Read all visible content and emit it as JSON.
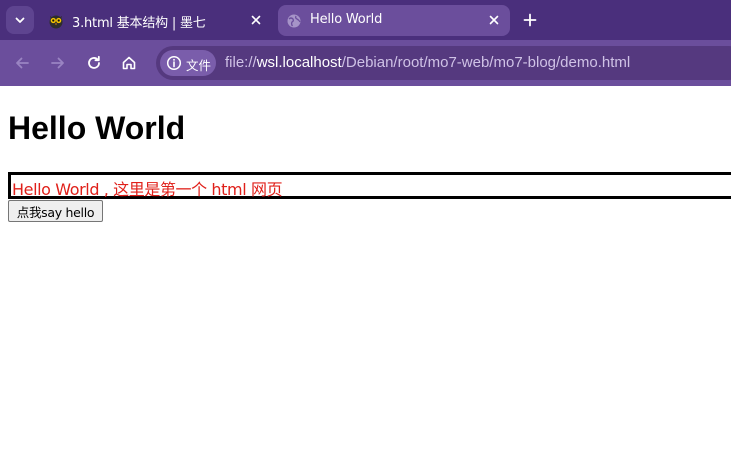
{
  "browser": {
    "tabs": [
      {
        "title": "3.html 基本结构 | 墨七",
        "active": false,
        "favicon": "owl-icon"
      },
      {
        "title": "Hello World",
        "active": true,
        "favicon": "globe-icon"
      }
    ],
    "address_bar": {
      "chip_label": "文件",
      "url_scheme": "file://",
      "url_host": "wsl.localhost",
      "url_path": "/Debian/root/mo7-web/mo7-blog/demo.html"
    },
    "colors": {
      "tabstrip": "#4a2f7c",
      "toolbar": "#6b4e9c",
      "omnibox": "#55397f"
    }
  },
  "page": {
    "heading": "Hello World",
    "input_value": "Hello World , 这里是第一个 html 网页",
    "input_text_color": "#e0201a",
    "button_label": "点我say hello"
  }
}
